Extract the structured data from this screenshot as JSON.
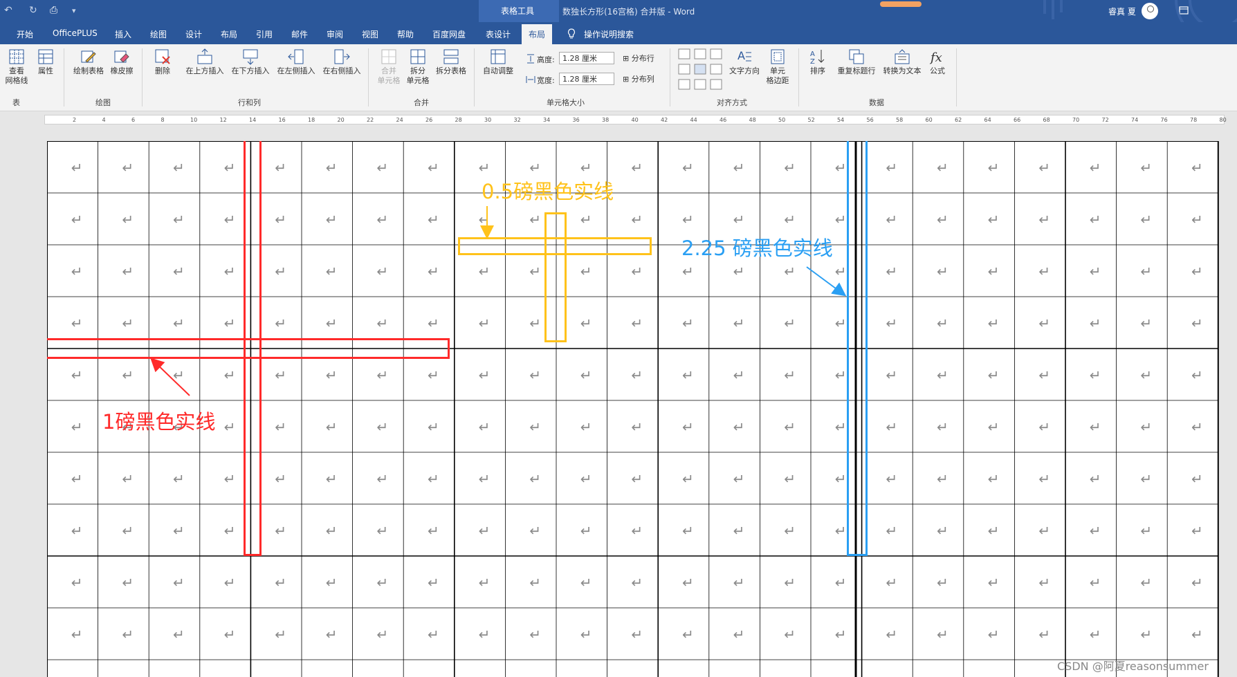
{
  "titlebar": {
    "context_tab": "表格工具",
    "document_title": "数独长方形(16宫格) 合并版  -  Word",
    "user_name": "睿真 夏"
  },
  "qat": {
    "undo": "↶",
    "redo": "↻",
    "print": "⎙",
    "more": "▾"
  },
  "tabs": [
    {
      "label": "开始"
    },
    {
      "label": "OfficePLUS"
    },
    {
      "label": "插入"
    },
    {
      "label": "绘图"
    },
    {
      "label": "设计"
    },
    {
      "label": "布局"
    },
    {
      "label": "引用"
    },
    {
      "label": "邮件"
    },
    {
      "label": "审阅"
    },
    {
      "label": "视图"
    },
    {
      "label": "帮助"
    },
    {
      "label": "百度网盘"
    },
    {
      "label": "表设计"
    },
    {
      "label": "布局"
    }
  ],
  "tell_me": "操作说明搜索",
  "ribbon": {
    "table": {
      "view_gridlines": "查看\n网格线",
      "properties": "属性",
      "group": "表"
    },
    "draw": {
      "draw_table": "绘制表格",
      "eraser": "橡皮擦",
      "group": "绘图"
    },
    "rows_cols": {
      "delete": "删除",
      "insert_above": "在上方插入",
      "insert_below": "在下方插入",
      "insert_left": "在左侧插入",
      "insert_right": "在右侧插入",
      "group": "行和列"
    },
    "merge": {
      "merge_cells": "合并\n单元格",
      "split_cells": "拆分\n单元格",
      "split_table": "拆分表格",
      "group": "合并"
    },
    "cell_size": {
      "autofit": "自动调整",
      "height_label": "高度:",
      "height_value": "1.28 厘米",
      "width_label": "宽度:",
      "width_value": "1.28 厘米",
      "distribute_rows": "分布行",
      "distribute_cols": "分布列",
      "group": "单元格大小"
    },
    "alignment": {
      "text_direction": "文字方向",
      "cell_margins": "单元\n格边距",
      "group": "对齐方式"
    },
    "data": {
      "sort": "排序",
      "repeat_header": "重复标题行",
      "convert_text": "转换为文本",
      "formula": "公式",
      "group": "数据"
    }
  },
  "ruler_labels": [
    "2",
    "4",
    "6",
    "8",
    "10",
    "12",
    "14",
    "16",
    "18",
    "20",
    "22",
    "24",
    "26",
    "28",
    "30",
    "32",
    "34",
    "36",
    "38",
    "40",
    "42",
    "44",
    "46",
    "48",
    "50",
    "52",
    "54",
    "56",
    "58",
    "60",
    "62",
    "64",
    "66",
    "68",
    "70",
    "72",
    "74",
    "76",
    "78",
    "80"
  ],
  "table": {
    "cols": 23,
    "rows": 11,
    "cell_mark": "↵"
  },
  "annotations": {
    "red": {
      "text": "1磅黑色实线",
      "color": "#ff2a2a"
    },
    "yellow": {
      "text": "0.5磅黑色实线",
      "color": "#ffc21a"
    },
    "blue": {
      "text": "2.25 磅黑色实线",
      "color": "#2a9ff3"
    }
  },
  "watermark": "CSDN @阿夏reasonsummer"
}
